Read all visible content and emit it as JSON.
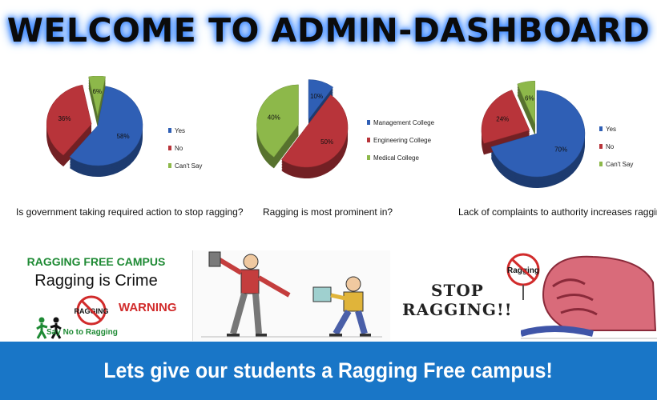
{
  "header": {
    "title": "WELCOME TO ADMIN-DASHBOARD"
  },
  "colors": {
    "blue": "#2f5fb5",
    "red": "#b8343a",
    "green": "#8db84a",
    "accent": "#1976c7"
  },
  "charts": [
    {
      "question": "Is government taking required action to stop ragging?",
      "slices": [
        {
          "label": "Yes",
          "value": 58,
          "display": "58%"
        },
        {
          "label": "No",
          "value": 36,
          "display": "36%"
        },
        {
          "label": "Can't Say",
          "value": 6,
          "display": "6%"
        }
      ]
    },
    {
      "question": "Ragging is most prominent in?",
      "slices": [
        {
          "label": "Management College",
          "value": 10,
          "display": "10%"
        },
        {
          "label": "Engineering College",
          "value": 50,
          "display": "50%"
        },
        {
          "label": "Medical College",
          "value": 40,
          "display": "40%"
        }
      ]
    },
    {
      "question": "Lack of complaints to authority increases ragging?",
      "slices": [
        {
          "label": "Yes",
          "value": 70,
          "display": "70%"
        },
        {
          "label": "No",
          "value": 24,
          "display": "24%"
        },
        {
          "label": "Can't Say",
          "value": 6,
          "display": "6%"
        }
      ]
    }
  ],
  "chart_data": [
    {
      "type": "pie",
      "categories": [
        "Yes",
        "No",
        "Can't Say"
      ],
      "values": [
        58,
        36,
        6
      ],
      "title": "",
      "question": "Is government taking required action to stop ragging?",
      "legend": "right"
    },
    {
      "type": "pie",
      "categories": [
        "Management College",
        "Engineering College",
        "Medical College"
      ],
      "values": [
        10,
        50,
        40
      ],
      "title": "",
      "question": "Ragging is most prominent in?",
      "legend": "right"
    },
    {
      "type": "pie",
      "categories": [
        "Yes",
        "No",
        "Can't Say"
      ],
      "values": [
        70,
        24,
        6
      ],
      "title": "",
      "question": "Lack of complaints to authority increases ragging?",
      "legend": "right"
    }
  ],
  "banners": {
    "left": {
      "heading": "RAGGING FREE CAMPUS",
      "subheading": "Ragging is Crime",
      "sign_text": "RAGGING",
      "warning": "WARNING",
      "tagline": "Say No to Ragging"
    },
    "right": {
      "stop_line1": "STOP",
      "stop_line2": "RAGGING!!",
      "sign_text": "Ragging"
    }
  },
  "footer": {
    "text": "Lets give our students a Ragging Free campus!"
  }
}
